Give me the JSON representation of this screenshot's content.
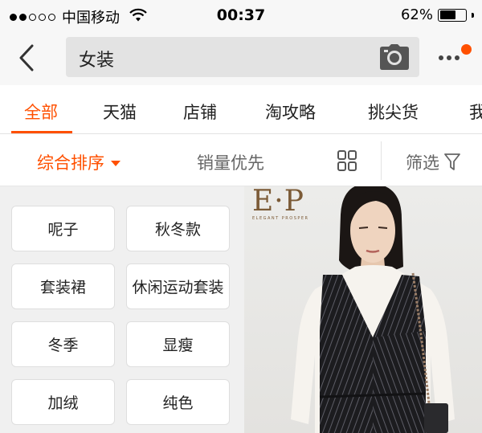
{
  "status_bar": {
    "carrier": "中国移动",
    "time": "00:37",
    "battery_percent": "62%",
    "battery_level": 0.62,
    "signal_bars": 2
  },
  "search": {
    "query": "女装"
  },
  "tabs": [
    {
      "label": "全部",
      "active": true
    },
    {
      "label": "天猫",
      "active": false
    },
    {
      "label": "店铺",
      "active": false
    },
    {
      "label": "淘攻略",
      "active": false
    },
    {
      "label": "挑尖货",
      "active": false
    },
    {
      "label": "我",
      "active": false
    }
  ],
  "sort": {
    "default_label": "综合排序",
    "sales_label": "销量优先",
    "filter_label": "筛选"
  },
  "tags": [
    "呢子",
    "秋冬款",
    "套装裙",
    "休闲运动套装",
    "冬季",
    "显瘦",
    "加绒",
    "纯色"
  ],
  "product": {
    "brand": "E·P",
    "brand_tagline": "ELEGANT PROSPER"
  },
  "colors": {
    "accent": "#ff5000",
    "header_bg": "#f7f7f7",
    "panel_bg": "#f0f0f0"
  },
  "icons": [
    "back-icon",
    "camera-icon",
    "more-icon",
    "grid-view-icon",
    "filter-icon",
    "wifi-icon",
    "battery-icon"
  ]
}
